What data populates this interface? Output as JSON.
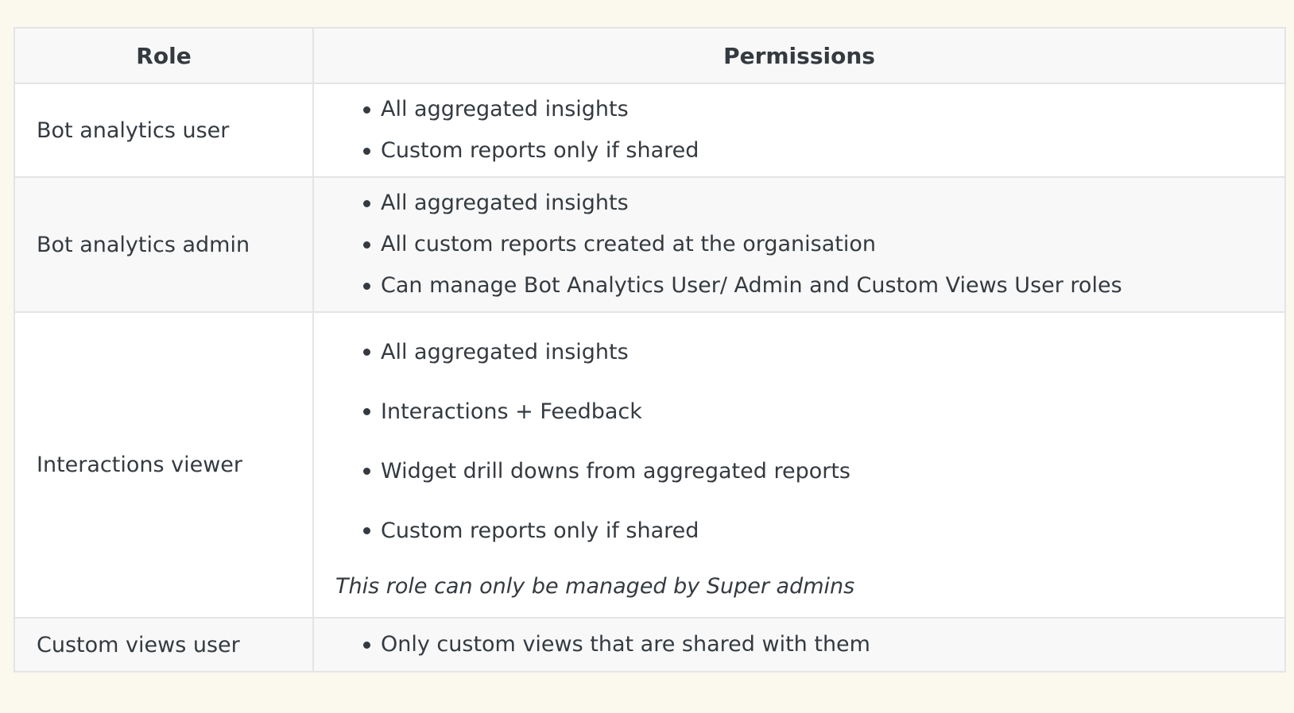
{
  "table": {
    "headers": {
      "role": "Role",
      "permissions": "Permissions"
    },
    "rows": [
      {
        "role": "Bot analytics user",
        "permissions": [
          "All aggregated insights",
          "Custom reports only if shared"
        ]
      },
      {
        "role": "Bot analytics admin",
        "permissions": [
          "All aggregated insights",
          "All custom reports created at the organisation",
          "Can manage Bot Analytics User/ Admin and Custom Views User roles"
        ]
      },
      {
        "role": "Interactions viewer",
        "permissions": [
          "All aggregated insights",
          "Interactions + Feedback",
          "Widget drill downs from aggregated reports",
          "Custom reports only if shared"
        ],
        "note": "This role can only be managed by Super admins"
      },
      {
        "role": "Custom views user",
        "permissions": [
          "Only custom views that are shared with them"
        ]
      }
    ]
  }
}
